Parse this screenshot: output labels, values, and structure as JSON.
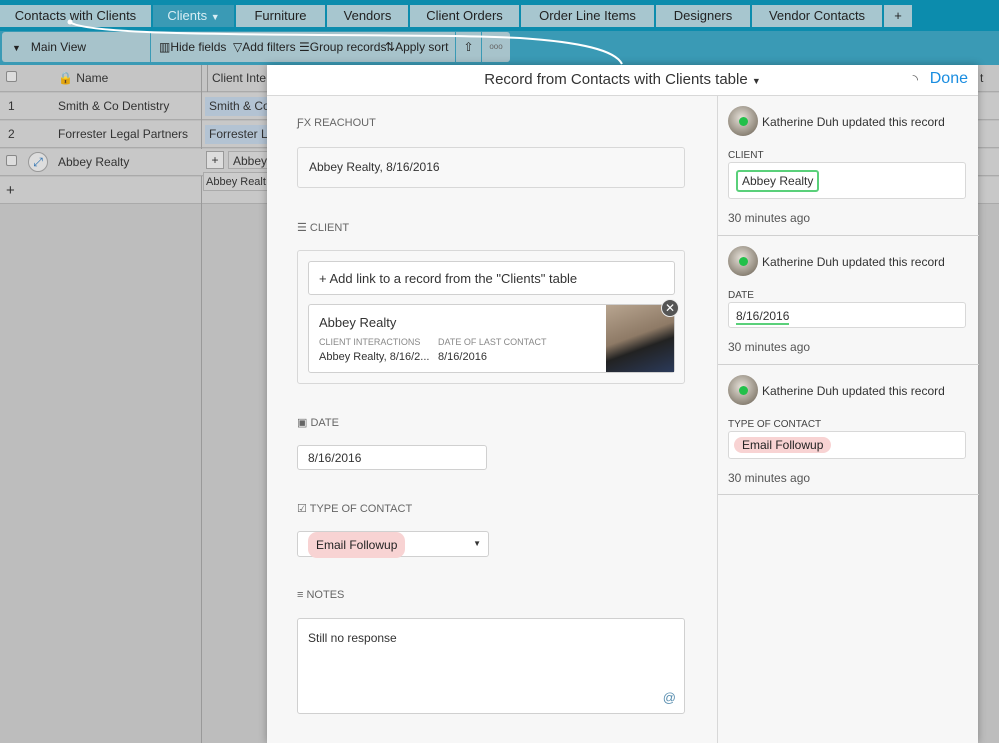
{
  "tabs": [
    {
      "label": "Contacts with Clients"
    },
    {
      "label": "Clients"
    },
    {
      "label": "Furniture"
    },
    {
      "label": "Vendors"
    },
    {
      "label": "Client Orders"
    },
    {
      "label": "Order Line Items"
    },
    {
      "label": "Designers"
    },
    {
      "label": "Vendor Contacts"
    },
    {
      "label": "+"
    }
  ],
  "toolbar": {
    "view": "Main View",
    "hide_fields": "Hide fields",
    "add_filters": "Add filters",
    "group_records": "Group records",
    "apply_sort": "Apply sort"
  },
  "grid": {
    "col_name": "Name",
    "col_client": "Client Inte",
    "col_right": "t Sp",
    "rows": [
      {
        "num": "1",
        "name": "Smith & Co Dentistry",
        "client": "Smith & Co"
      },
      {
        "num": "2",
        "name": "Forrester Legal Partners",
        "client": "Forrester Le"
      },
      {
        "num": "",
        "name": "Abbey Realty",
        "client": "Abbey",
        "client2": "Abbey Realt"
      }
    ],
    "add": "+"
  },
  "modal": {
    "title": "Record from Contacts with Clients table",
    "done": "Done",
    "reachout": {
      "label": "REACHOUT",
      "value": "Abbey Realty, 8/16/2016"
    },
    "client": {
      "label": "CLIENT",
      "add_link": "+ Add link to a record from the \"Clients\" table",
      "card": {
        "name": "Abbey Realty",
        "f1_label": "CLIENT INTERACTIONS",
        "f1_value": "Abbey Realty, 8/16/2...",
        "f2_label": "DATE OF LAST CONTACT",
        "f2_value": "8/16/2016"
      }
    },
    "date": {
      "label": "DATE",
      "value": "8/16/2016"
    },
    "type": {
      "label": "TYPE OF CONTACT",
      "value": "Email Followup"
    },
    "notes": {
      "label": "NOTES",
      "value": "Still no response"
    }
  },
  "activity": [
    {
      "who": "Katherine Duh updated this record",
      "field": "CLIENT",
      "value": "Abbey Realty",
      "ago": "30 minutes ago"
    },
    {
      "who": "Katherine Duh updated this record",
      "field": "DATE",
      "value": "8/16/2016",
      "ago": "30 minutes ago"
    },
    {
      "who": "Katherine Duh updated this record",
      "field": "TYPE OF CONTACT",
      "value": "Email Followup",
      "ago": "30 minutes ago"
    }
  ],
  "colors": {
    "accent": "#1a8de0",
    "tabbar": "#0c8cad",
    "online": "#22c04a",
    "pill": "#f8d3d3"
  }
}
